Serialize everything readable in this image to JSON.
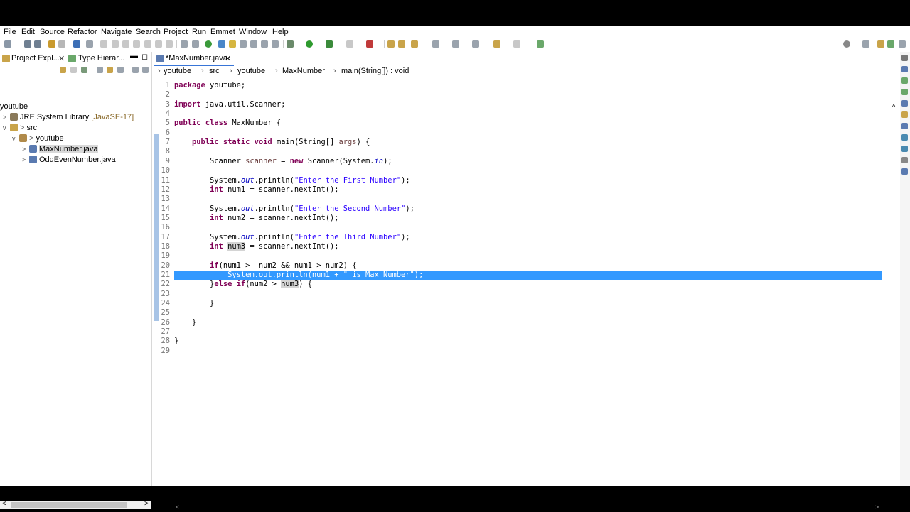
{
  "menu": [
    "File",
    "Edit",
    "Source",
    "Refactor",
    "Navigate",
    "Search",
    "Project",
    "Run",
    "Emmet",
    "Window",
    "Help"
  ],
  "left_panel": {
    "tab_project": "Project Expl...",
    "tab_type": "Type Hierar...",
    "root": "youtube",
    "tree": [
      {
        "label": "JRE System Library",
        "suffix": " [JavaSE-17]"
      },
      {
        "label": "src"
      },
      {
        "label": "youtube"
      },
      {
        "label": "MaxNumber.java"
      },
      {
        "label": "OddEvenNumber.java"
      }
    ]
  },
  "editor": {
    "tab_label": "*MaxNumber.java",
    "breadcrumb": [
      "youtube",
      "src",
      "youtube",
      "MaxNumber",
      "main(String[]) : void"
    ],
    "selected_line": 21,
    "lines": [
      "package youtube;",
      "",
      "import java.util.Scanner;",
      "",
      "public class MaxNumber {",
      "",
      "    public static void main(String[] args) {",
      "",
      "        Scanner scanner = new Scanner(System.in);",
      "",
      "        System.out.println(\"Enter the First Number\");",
      "        int num1 = scanner.nextInt();",
      "",
      "        System.out.println(\"Enter the Second Number\");",
      "        int num2 = scanner.nextInt();",
      "",
      "        System.out.println(\"Enter the Third Number\");",
      "        int num3 = scanner.nextInt();",
      "",
      "        if(num1 >  num2 && num1 > num2) {",
      "            System.out.println(num1 + \" is Max Number\");",
      "        }else if(num2 > num3) {",
      "",
      "        }",
      "",
      "    }",
      "",
      "}",
      ""
    ]
  },
  "colors": {
    "selection": "#3399ff",
    "keyword": "#7f0055",
    "string": "#2a00ff"
  }
}
